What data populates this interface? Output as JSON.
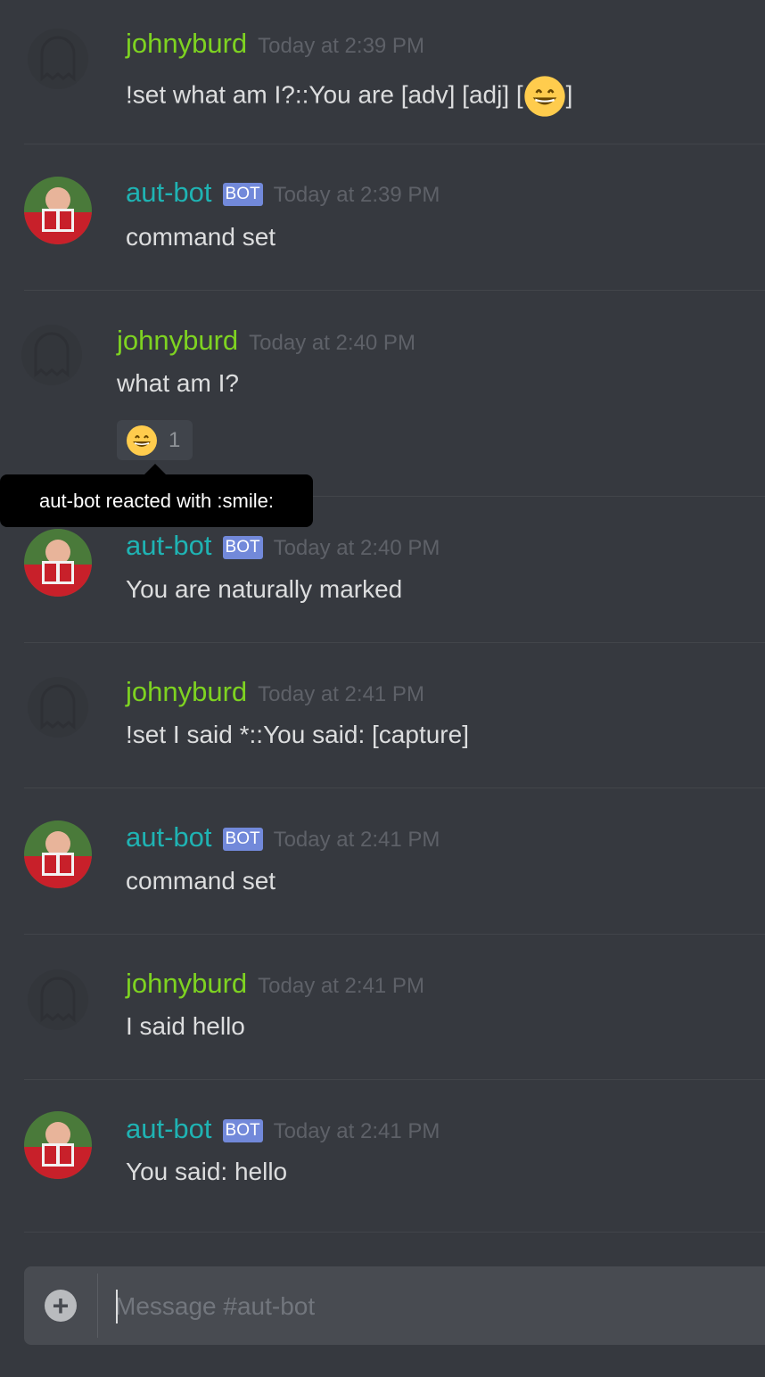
{
  "messages": [
    {
      "author": "johnyburd",
      "timestamp": "Today at 2:39 PM",
      "text_pre": "!set what am I?::You are [adv] [adj] [",
      "text_post": "]"
    },
    {
      "author": "aut-bot",
      "bot_badge": "BOT",
      "timestamp": "Today at 2:39 PM",
      "text": "command set"
    },
    {
      "author": "johnyburd",
      "timestamp": "Today at 2:40 PM",
      "text": "what am I?",
      "reaction": {
        "emoji": "smile-emoji",
        "count": "1",
        "tooltip": "aut-bot reacted with :smile:"
      }
    },
    {
      "author": "aut-bot",
      "bot_badge": "BOT",
      "timestamp": "Today at 2:40 PM",
      "text": "You are naturally marked"
    },
    {
      "author": "johnyburd",
      "timestamp": "Today at 2:41 PM",
      "text": "!set I said *::You said: [capture]"
    },
    {
      "author": "aut-bot",
      "bot_badge": "BOT",
      "timestamp": "Today at 2:41 PM",
      "text": "command set"
    },
    {
      "author": "johnyburd",
      "timestamp": "Today at 2:41 PM",
      "text": "I said hello"
    },
    {
      "author": "aut-bot",
      "bot_badge": "BOT",
      "timestamp": "Today at 2:41 PM",
      "text": "You said: hello"
    }
  ],
  "composer": {
    "placeholder": "Message #aut-bot",
    "attach_icon": "plus-circle-icon"
  },
  "colors": {
    "background": "#36393f",
    "user_name": "#7ed321",
    "bot_name": "#1fb3b3",
    "badge": "#7289da"
  }
}
